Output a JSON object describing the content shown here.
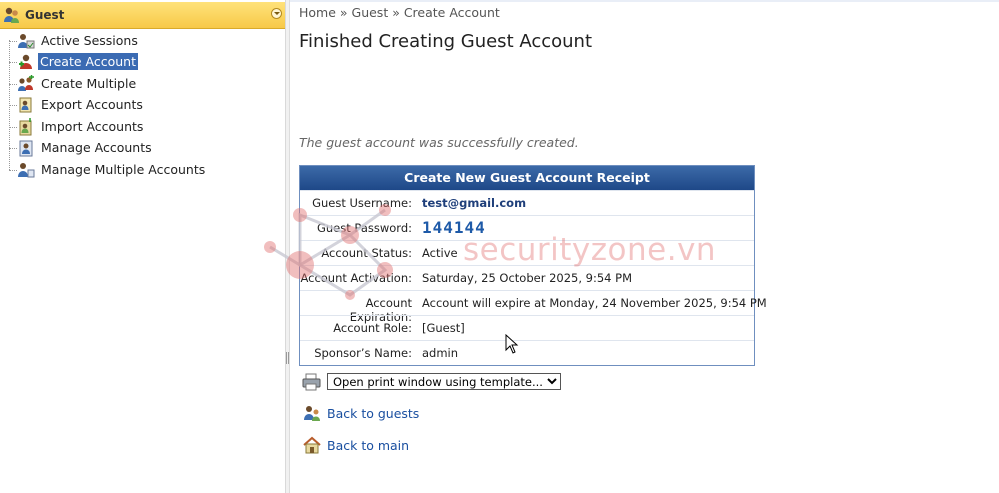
{
  "sidebar": {
    "header_title": "Guest",
    "items": [
      {
        "label": "Active Sessions",
        "icon": "active-sessions-icon"
      },
      {
        "label": "Create Account",
        "icon": "create-account-icon",
        "selected": true
      },
      {
        "label": "Create Multiple",
        "icon": "create-multiple-icon"
      },
      {
        "label": "Export Accounts",
        "icon": "export-accounts-icon"
      },
      {
        "label": "Import Accounts",
        "icon": "import-accounts-icon"
      },
      {
        "label": "Manage Accounts",
        "icon": "manage-accounts-icon"
      },
      {
        "label": "Manage Multiple Accounts",
        "icon": "manage-multiple-accounts-icon"
      }
    ]
  },
  "breadcrumb": "Home » Guest » Create Account",
  "page_title": "Finished Creating Guest Account",
  "success_message": "The guest account was successfully created.",
  "receipt": {
    "title": "Create New Guest Account Receipt",
    "rows": [
      {
        "label": "Guest Username:",
        "value": "test@gmail.com"
      },
      {
        "label": "Guest Password:",
        "value": "144144"
      },
      {
        "label": "Account Status:",
        "value": "Active"
      },
      {
        "label": "Account Activation:",
        "value": "Saturday, 25 October 2025, 9:54 PM"
      },
      {
        "label": "Account Expiration:",
        "value": "Account will expire at Monday, 24 November 2025, 9:54 PM"
      },
      {
        "label": "Account Role:",
        "value": "[Guest]"
      },
      {
        "label": "Sponsor’s Name:",
        "value": "admin"
      }
    ]
  },
  "actions": {
    "print_select": "Open print window using template...",
    "back_to_guests": "Back to guests",
    "back_to_main": "Back to main"
  },
  "watermark": "securityzone.vn",
  "colors": {
    "sidebar_header": "#f7c948",
    "selected_item": "#3b6bb3",
    "receipt_header": "#1e4888",
    "link": "#1a4fa0",
    "password": "#1e5aa8"
  }
}
